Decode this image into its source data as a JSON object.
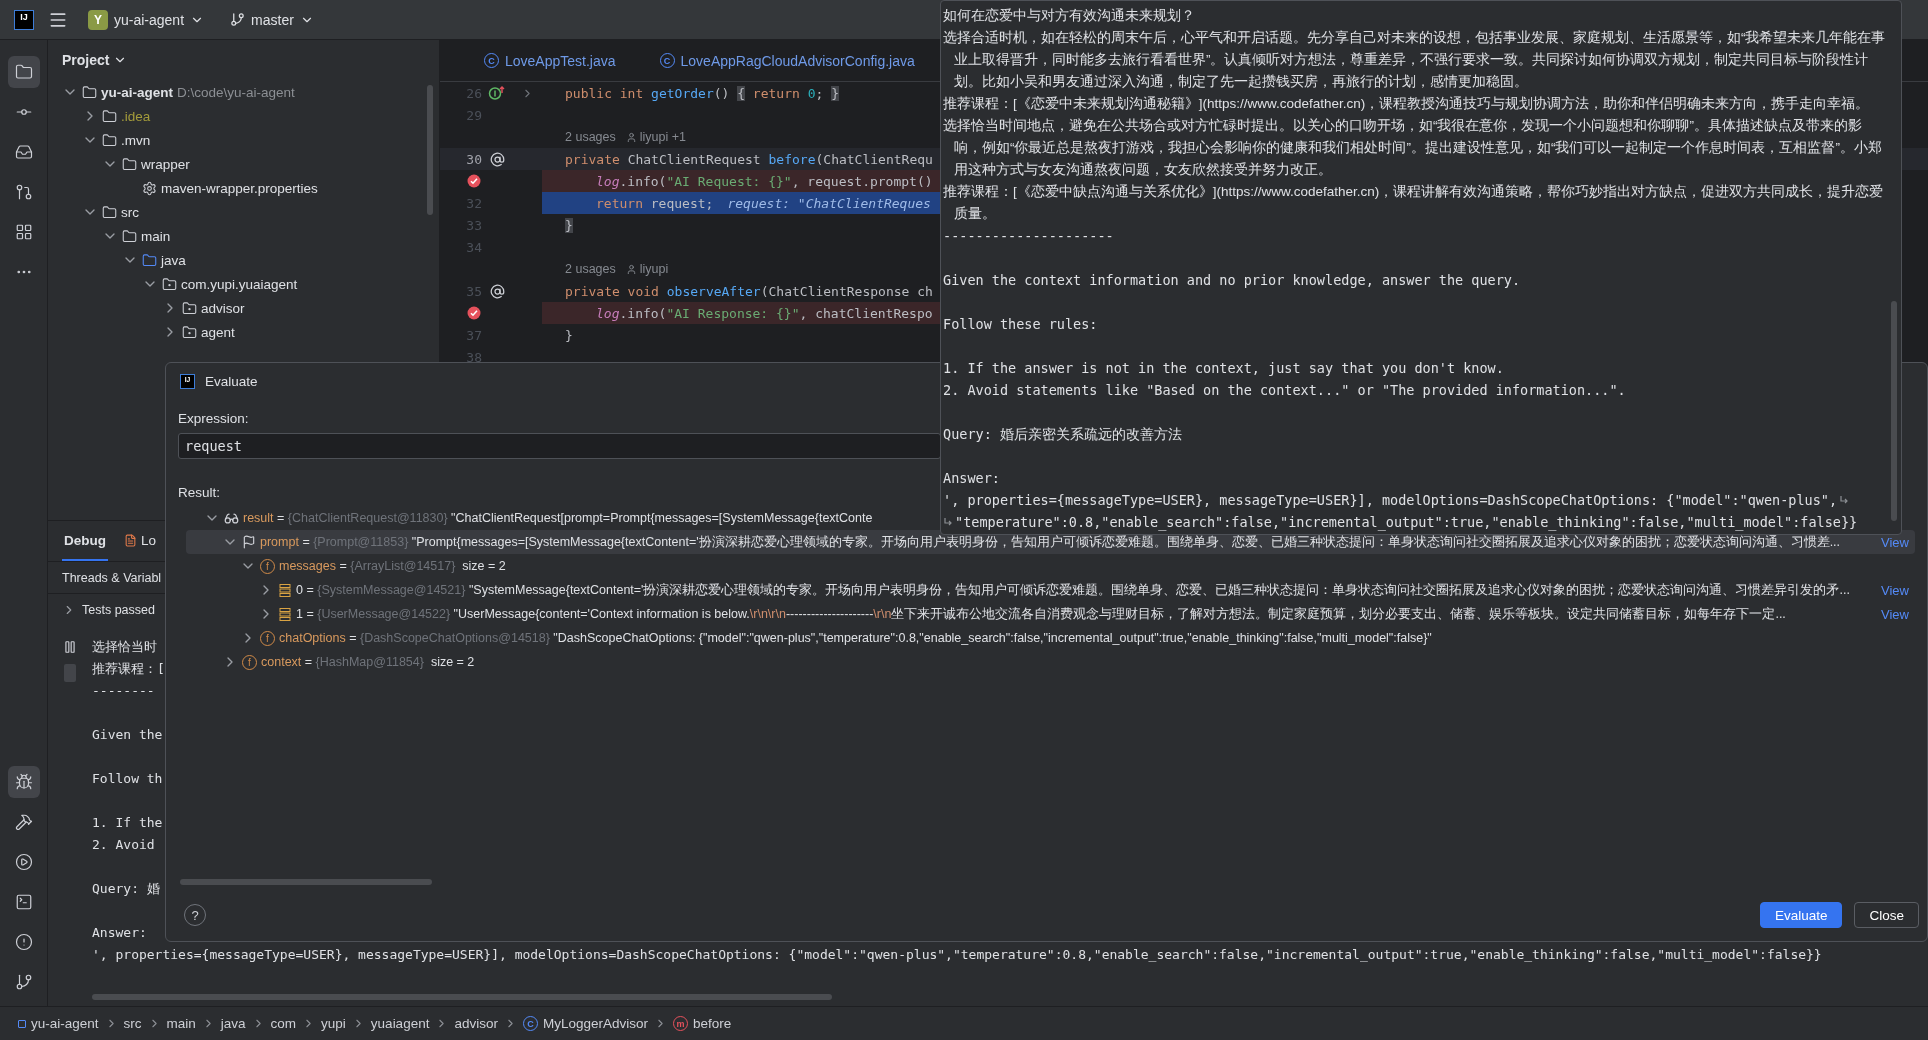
{
  "title_bar": {
    "logo": "IJ",
    "project_badge": "Y",
    "project": "yu-ai-agent",
    "branch": "master"
  },
  "tool_strip": {
    "top": [
      {
        "kind": "folder",
        "selected": true
      },
      {
        "kind": "commit",
        "selected": false
      },
      {
        "kind": "inbox",
        "selected": false
      },
      {
        "kind": "pull-requests",
        "selected": false
      },
      {
        "kind": "structure",
        "selected": false
      },
      {
        "kind": "more",
        "selected": false
      }
    ],
    "bottom": [
      {
        "kind": "debug",
        "selected": true
      },
      {
        "kind": "build",
        "selected": false
      },
      {
        "kind": "run",
        "selected": false
      },
      {
        "kind": "terminal",
        "selected": false
      },
      {
        "kind": "problems",
        "selected": false
      },
      {
        "kind": "git",
        "selected": false
      }
    ]
  },
  "project": {
    "title": "Project",
    "tree": [
      {
        "kind": "module",
        "label": "yu-ai-agent",
        "path": "D:\\code\\yu-ai-agent",
        "expanded": true,
        "children": [
          {
            "kind": "folder-ignored",
            "label": ".idea",
            "expanded": false
          },
          {
            "kind": "folder",
            "label": ".mvn",
            "expanded": true,
            "children": [
              {
                "kind": "folder",
                "label": "wrapper",
                "expanded": true,
                "children": [
                  {
                    "kind": "file",
                    "label": "maven-wrapper.properties"
                  }
                ]
              }
            ]
          },
          {
            "kind": "folder",
            "label": "src",
            "expanded": true,
            "children": [
              {
                "kind": "folder",
                "label": "main",
                "expanded": true,
                "children": [
                  {
                    "kind": "source-root",
                    "label": "java",
                    "expanded": true,
                    "children": [
                      {
                        "kind": "package",
                        "label": "com.yupi.yuaiagent",
                        "expanded": true,
                        "children": [
                          {
                            "kind": "package",
                            "label": "advisor",
                            "expanded": false
                          },
                          {
                            "kind": "package",
                            "label": "agent",
                            "expanded": false
                          }
                        ]
                      }
                    ]
                  }
                ]
              }
            ]
          }
        ]
      }
    ]
  },
  "editor": {
    "tabs": [
      {
        "glyph": "C",
        "label": "LoveAppTest.java"
      },
      {
        "glyph": "C",
        "label": "LoveAppRagCloudAdvisorConfig.java"
      }
    ],
    "lines": [
      {
        "kind": "code",
        "number": "26",
        "gutter_icon": {
          "kind": "implements"
        },
        "folded": true,
        "breakpoint": false,
        "current": false,
        "caret": false,
        "indented": false,
        "tokens": [
          {
            "kind": "keyword",
            "text": "public int "
          },
          {
            "kind": "method",
            "text": "getOrder"
          },
          {
            "kind": "plain",
            "text": "() "
          },
          {
            "kind": "fold",
            "text": "{"
          },
          {
            "kind": "keyword",
            "text": " return "
          },
          {
            "kind": "number",
            "text": "0"
          },
          {
            "kind": "plain",
            "text": "; "
          },
          {
            "kind": "fold",
            "text": "}"
          }
        ]
      },
      {
        "kind": "code",
        "number": "29"
      },
      {
        "kind": "hint",
        "usages": "2 usages",
        "author": "liyupi +1"
      },
      {
        "kind": "code",
        "number": "30",
        "gutter_icon": {
          "kind": "at"
        },
        "folded": false,
        "breakpoint": false,
        "current": false,
        "caret": true,
        "indented": false,
        "tokens": [
          {
            "kind": "keyword",
            "text": "private "
          },
          {
            "kind": "plain",
            "text": "ChatClientRequest "
          },
          {
            "kind": "method",
            "text": "before"
          },
          {
            "kind": "plain",
            "text": "(ChatClientRequ"
          }
        ]
      },
      {
        "kind": "code",
        "folded": false,
        "breakpoint": true,
        "current": false,
        "caret": false,
        "indented": true,
        "tokens": [
          {
            "kind": "log",
            "text": "log"
          },
          {
            "kind": "plain",
            "text": ".info("
          },
          {
            "kind": "string",
            "text": "\"AI Request: {}\""
          },
          {
            "kind": "plain",
            "text": ", request.prompt()"
          }
        ]
      },
      {
        "kind": "code",
        "number": "32",
        "folded": false,
        "breakpoint": false,
        "current": true,
        "caret": false,
        "indented": true,
        "tokens": [
          {
            "kind": "keyword",
            "text": "return "
          },
          {
            "kind": "plain",
            "text": "request;"
          },
          {
            "kind": "inline",
            "text": "request: \"ChatClientReques"
          }
        ]
      },
      {
        "kind": "code",
        "number": "33",
        "folded": false,
        "breakpoint": false,
        "current": false,
        "caret": false,
        "indented": false,
        "tokens": [
          {
            "kind": "fold",
            "text": "}"
          }
        ]
      },
      {
        "kind": "code",
        "number": "34"
      },
      {
        "kind": "hint",
        "usages": "2 usages",
        "author": "liyupi"
      },
      {
        "kind": "code",
        "number": "35",
        "gutter_icon": {
          "kind": "at"
        },
        "folded": false,
        "breakpoint": false,
        "current": false,
        "caret": false,
        "indented": false,
        "tokens": [
          {
            "kind": "keyword",
            "text": "private void "
          },
          {
            "kind": "method",
            "text": "observeAfter"
          },
          {
            "kind": "plain",
            "text": "(ChatClientResponse ch"
          }
        ]
      },
      {
        "kind": "code",
        "folded": false,
        "breakpoint": true,
        "current": false,
        "caret": false,
        "indented": true,
        "tokens": [
          {
            "kind": "log",
            "text": "log"
          },
          {
            "kind": "plain",
            "text": ".info("
          },
          {
            "kind": "string",
            "text": "\"AI Response: {}\""
          },
          {
            "kind": "plain",
            "text": ", chatClientRespo"
          }
        ]
      },
      {
        "kind": "code",
        "number": "37",
        "folded": false,
        "breakpoint": false,
        "current": false,
        "caret": false,
        "indented": false,
        "tokens": [
          {
            "kind": "plain",
            "text": "}"
          }
        ]
      },
      {
        "kind": "code",
        "number": "38"
      }
    ]
  },
  "debug": {
    "tabs": [
      {
        "label": "Debug",
        "selected": true
      },
      {
        "label": "Lo",
        "selected": false
      }
    ],
    "threads_header": "Threads & Variabl",
    "tests": "Tests passed",
    "console": [
      {
        "text": "选择恰当时",
        "spaced": false
      },
      {
        "text": "推荐课程：[",
        "spaced": false
      },
      {
        "text": "--------",
        "spaced": false
      },
      {
        "text": "Given the",
        "spaced": true
      },
      {
        "text": "Follow th",
        "spaced": true
      },
      {
        "text": "1. If the",
        "spaced": true
      },
      {
        "text": "2. Avoid",
        "spaced": false
      },
      {
        "text": "Query: 婚",
        "spaced": true
      },
      {
        "text": "Answer:",
        "spaced": true
      },
      {
        "text": "', properties={messageType=USER}, messageType=USER}], modelOptions=DashScopeChatOptions: {\"model\":\"qwen-plus\",\"temperature\":0.8,\"enable_search\":false,\"incremental_output\":true,\"enable_thinking\":false,\"multi_model\":false}}",
        "spaced": false
      }
    ]
  },
  "tooltip": {
    "lines": [
      {
        "kind": "text",
        "spaced": false,
        "text": "如何在恋爱中与对方有效沟通未来规划？"
      },
      {
        "kind": "text",
        "spaced": false,
        "text": "选择合适时机，如在轻松的周末午后，心平气和开启话题。先分享自己对未来的设想，包括事业发展、家庭规划、生活愿景等，如“我希望未来几年能在事业上取得晋升，同时能多去旅行看看世界”。认真倾听对方想法，尊重差异，不强行要求一致。共同探讨如何协调双方规划，制定共同目标与阶段性计划。比如小吴和男友通过深入沟通，制定了先一起攒钱买房，再旅行的计划，感情更加稳固。"
      },
      {
        "kind": "text",
        "spaced": false,
        "text": "推荐课程：[《恋爱中未来规划沟通秘籍》](https://www.codefather.cn)，课程教授沟通技巧与规划协调方法，助你和伴侣明确未来方向，携手走向幸福。"
      },
      {
        "kind": "text",
        "spaced": false,
        "text": "选择恰当时间地点，避免在公共场合或对方忙碌时提出。以关心的口吻开场，如“我很在意你，发现一个小问题想和你聊聊”。具体描述缺点及带来的影响，例如“你最近总是熬夜打游戏，我担心会影响你的健康和我们相处时间”。提出建设性意见，如“我们可以一起制定一个作息时间表，互相监督”。小郑用这种方式与女友沟通熬夜问题，女友欣然接受并努力改正。"
      },
      {
        "kind": "text",
        "spaced": false,
        "text": "推荐课程：[《恋爱中缺点沟通与关系优化》](https://www.codefather.cn)，课程讲解有效沟通策略，帮你巧妙指出对方缺点，促进双方共同成长，提升恋爱质量。"
      },
      {
        "kind": "text",
        "spaced": false,
        "text": "---------------------"
      },
      {
        "kind": "text",
        "spaced": true,
        "text": "Given the context information and no prior knowledge, answer the query."
      },
      {
        "kind": "text",
        "spaced": true,
        "text": "Follow these rules:"
      },
      {
        "kind": "text",
        "spaced": true,
        "text": "1. If the answer is not in the context, just say that you don't know."
      },
      {
        "kind": "text",
        "spaced": false,
        "text": "2. Avoid statements like \"Based on the context...\" or \"The provided information...\"."
      },
      {
        "kind": "text",
        "spaced": true,
        "text": "Query: 婚后亲密关系疏远的改善方法"
      },
      {
        "kind": "text",
        "spaced": true,
        "text": "Answer:"
      },
      {
        "kind": "wrap-end",
        "spaced": false,
        "text": "', properties={messageType=USER}, messageType=USER}], modelOptions=DashScopeChatOptions: {\"model\":\"qwen-plus\","
      },
      {
        "kind": "wrap-start",
        "spaced": false,
        "text": "\"temperature\":0.8,\"enable_search\":false,\"incremental_output\":true,\"enable_thinking\":false,\"multi_model\":false}}"
      }
    ]
  },
  "evaluate_dialog": {
    "logo": "IJ",
    "title": "Evaluate",
    "expression_label": "Expression:",
    "expression": "request",
    "result_label": "Result:",
    "tree": [
      {
        "kind": "watch",
        "expanded": true,
        "selected": false,
        "parts": [
          {
            "kind": "name",
            "text": "result"
          },
          {
            "kind": "plain",
            "text": " = "
          },
          {
            "kind": "type",
            "text": "{ChatClientRequest@11830} "
          },
          {
            "kind": "value",
            "text": "\"ChatClientRequest[prompt=Prompt{messages=[SystemMessage{textConte"
          }
        ],
        "children": [
          {
            "kind": "flag",
            "expanded": true,
            "selected": true,
            "link": "View",
            "parts": [
              {
                "kind": "name",
                "text": "prompt"
              },
              {
                "kind": "plain",
                "text": " = "
              },
              {
                "kind": "type",
                "text": "{Prompt@11853} "
              },
              {
                "kind": "value",
                "text": "\"Prompt{messages=[SystemMessage{textContent='扮演深耕恋爱心理领域的专家。开场向用户表明身份，告知用户可倾诉恋爱难题。围绕单身、恋爱、已婚三种状态提问：单身状态询问社交圈拓展及追求心仪对象的困扰；恋爱状态询问沟通、习惯差..."
              }
            ],
            "children": [
              {
                "kind": "field",
                "glyph": "f",
                "expanded": true,
                "selected": false,
                "parts": [
                  {
                    "kind": "name",
                    "text": "messages"
                  },
                  {
                    "kind": "plain",
                    "text": " = "
                  },
                  {
                    "kind": "type",
                    "text": "{ArrayList@14517} "
                  },
                  {
                    "kind": "plain",
                    "text": " size = 2"
                  }
                ],
                "children": [
                  {
                    "kind": "array",
                    "expanded": false,
                    "selected": false,
                    "link": "View",
                    "parts": [
                      {
                        "kind": "name",
                        "text": "0"
                      },
                      {
                        "kind": "plain",
                        "text": " = "
                      },
                      {
                        "kind": "type",
                        "text": "{SystemMessage@14521} "
                      },
                      {
                        "kind": "value",
                        "text": "\"SystemMessage{textContent='扮演深耕恋爱心理领域的专家。开场向用户表明身份，告知用户可倾诉恋爱难题。围绕单身、恋爱、已婚三种状态提问：单身状态询问社交圈拓展及追求心仪对象的困扰；恋爱状态询问沟通、习惯差异引发的矛..."
                      }
                    ]
                  },
                  {
                    "kind": "array",
                    "expanded": false,
                    "selected": false,
                    "link": "View",
                    "parts": [
                      {
                        "kind": "name",
                        "text": "1"
                      },
                      {
                        "kind": "plain",
                        "text": " = "
                      },
                      {
                        "kind": "type",
                        "text": "{UserMessage@14522} "
                      },
                      {
                        "kind": "value",
                        "text": "\"UserMessage{content='Context information is below."
                      },
                      {
                        "kind": "escape",
                        "text": "\\r\\n\\r\\n"
                      },
                      {
                        "kind": "value",
                        "text": "---------------------"
                      },
                      {
                        "kind": "escape",
                        "text": "\\r\\n"
                      },
                      {
                        "kind": "value",
                        "text": "坐下来开诚布公地交流各自消费观念与理财目标，了解对方想法。制定家庭预算，划分必要支出、储蓄、娱乐等板块。设定共同储蓄目标，如每年存下一定..."
                      }
                    ]
                  }
                ]
              },
              {
                "kind": "field",
                "glyph": "f",
                "expanded": false,
                "selected": false,
                "parts": [
                  {
                    "kind": "name",
                    "text": "chatOptions"
                  },
                  {
                    "kind": "plain",
                    "text": " = "
                  },
                  {
                    "kind": "type",
                    "text": "{DashScopeChatOptions@14518} "
                  },
                  {
                    "kind": "value",
                    "text": "\"DashScopeChatOptions: {\"model\":\"qwen-plus\",\"temperature\":0.8,\"enable_search\":false,\"incremental_output\":true,\"enable_thinking\":false,\"multi_model\":false}\""
                  }
                ]
              }
            ]
          },
          {
            "kind": "field",
            "glyph": "f",
            "expanded": false,
            "selected": false,
            "parts": [
              {
                "kind": "name",
                "text": "context"
              },
              {
                "kind": "plain",
                "text": " = "
              },
              {
                "kind": "type",
                "text": "{HashMap@11854} "
              },
              {
                "kind": "plain",
                "text": " size = 2"
              }
            ]
          }
        ]
      }
    ],
    "help": "?",
    "buttons": [
      {
        "kind": "primary",
        "label": "Evaluate"
      },
      {
        "kind": "secondary",
        "label": "Close"
      }
    ]
  },
  "breadcrumbs": [
    {
      "kind": "module",
      "label": "yu-ai-agent"
    },
    {
      "kind": "plain",
      "label": "src"
    },
    {
      "kind": "plain",
      "label": "main"
    },
    {
      "kind": "plain",
      "label": "java"
    },
    {
      "kind": "plain",
      "label": "com"
    },
    {
      "kind": "plain",
      "label": "yupi"
    },
    {
      "kind": "plain",
      "label": "yuaiagent"
    },
    {
      "kind": "plain",
      "label": "advisor"
    },
    {
      "kind": "class",
      "glyph": "C",
      "label": "MyLoggerAdvisor"
    },
    {
      "kind": "method",
      "glyph": "m",
      "label": "before"
    }
  ]
}
